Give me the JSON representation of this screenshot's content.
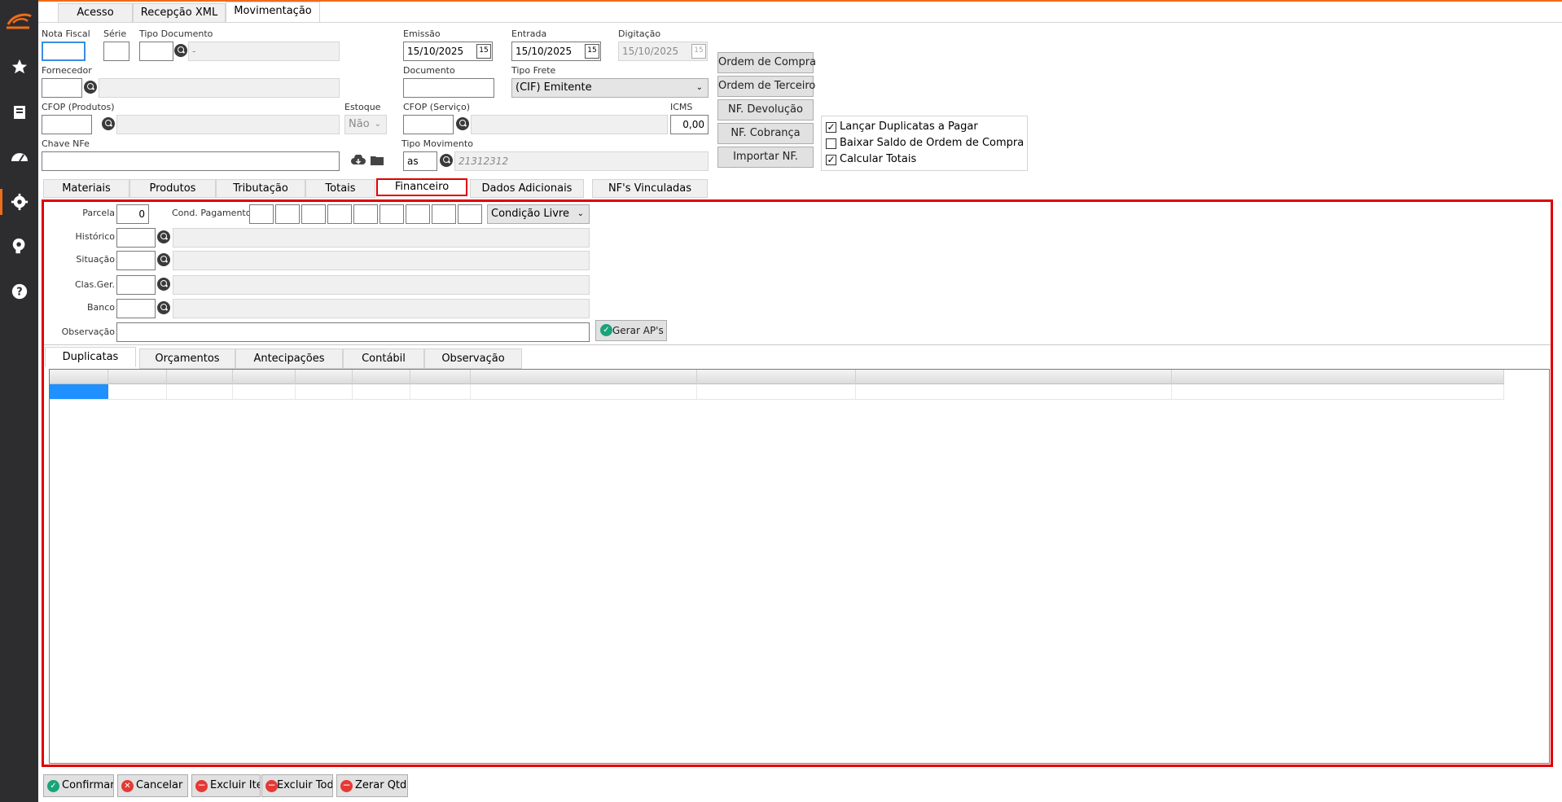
{
  "colors": {
    "accent": "#ee6c1a",
    "sidebar": "#2d2d30",
    "highlight_border": "#e00000",
    "selection": "#1e90ff"
  },
  "sidebar": {
    "icons": [
      "logo-icon",
      "star-icon",
      "book-icon",
      "dashboard-icon",
      "gear-icon",
      "support-icon",
      "help-icon"
    ]
  },
  "top_tabs": [
    "Acesso",
    "Recepção XML",
    "Movimentação"
  ],
  "header": {
    "nota_fiscal_label": "Nota Fiscal",
    "serie_label": "Série",
    "tipo_documento_label": "Tipo Documento",
    "tipo_documento_desc": "-",
    "emissao_label": "Emissão",
    "emissao_value": "15/10/2025",
    "entrada_label": "Entrada",
    "entrada_value": "15/10/2025",
    "digitacao_label": "Digitação",
    "digitacao_value": "15/10/2025",
    "fornecedor_label": "Fornecedor",
    "documento_label": "Documento",
    "tipo_frete_label": "Tipo Frete",
    "tipo_frete_value": "(CIF) Emitente",
    "cfop_produtos_label": "CFOP (Produtos)",
    "estoque_label": "Estoque",
    "estoque_value": "Não",
    "cfop_servico_label": "CFOP (Serviço)",
    "icms_label": "ICMS",
    "icms_value": "0,00",
    "chave_nfe_label": "Chave NFe",
    "tipo_movimento_label": "Tipo Movimento",
    "tipo_movimento_code": "as",
    "tipo_movimento_desc": "21312312"
  },
  "action_buttons": [
    "Ordem de Compra",
    "Ordem de Terceiro",
    "NF. Devolução",
    "NF. Cobrança",
    "Importar NF."
  ],
  "options": [
    {
      "label": "Lançar Duplicatas a Pagar",
      "checked": true
    },
    {
      "label": "Baixar Saldo de Ordem de Compra",
      "checked": false
    },
    {
      "label": "Calcular Totais",
      "checked": true
    }
  ],
  "section_tabs": [
    "Materiais",
    "Produtos",
    "Tributação",
    "Totais",
    "Financeiro",
    "Dados Adicionais",
    "NF's Vinculadas"
  ],
  "financeiro": {
    "parcela_label": "Parcela",
    "parcela_value": "0",
    "cond_pagamento_label": "Cond. Pagamento",
    "condicao_value": "Condição Livre",
    "historico_label": "Histórico",
    "situacao_label": "Situação",
    "clas_ger_label": "Clas.Ger.",
    "banco_label": "Banco",
    "observacao_label": "Observação",
    "gerar_aps_label": "Gerar AP's"
  },
  "inner_tabs": [
    "Duplicatas",
    "Orçamentos",
    "Antecipações",
    "Contábil",
    "Observação"
  ],
  "footer_buttons": [
    "Confirmar",
    "Cancelar",
    "Excluir Item",
    "Excluir Todos",
    "Zerar Qtde"
  ]
}
